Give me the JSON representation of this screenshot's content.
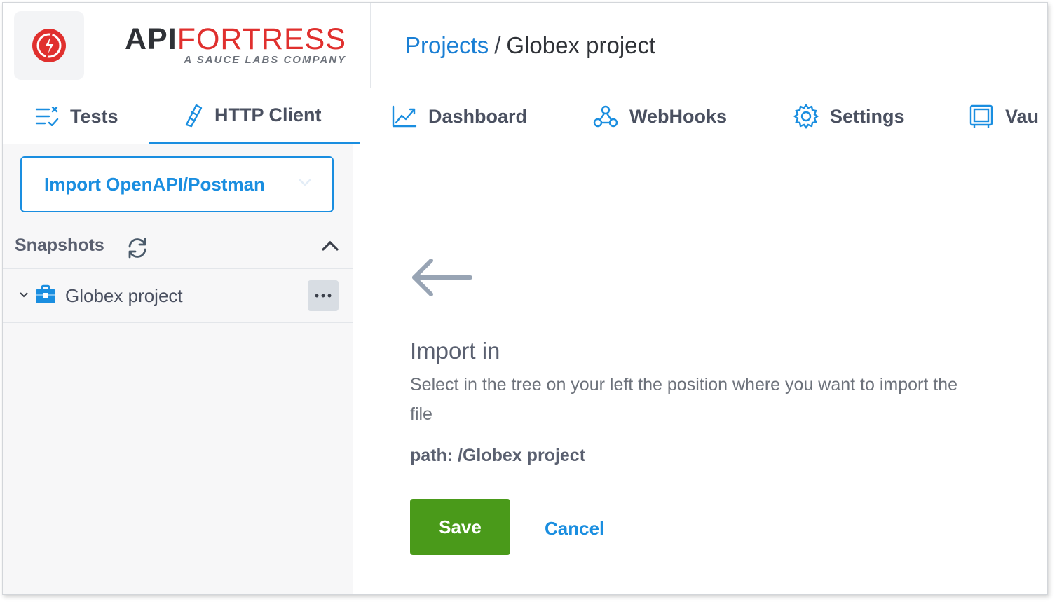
{
  "brand": {
    "api": "API",
    "fortress": "FORTRESS",
    "tagline": "A SAUCE LABS COMPANY"
  },
  "breadcrumb": {
    "link": "Projects",
    "separator": "/",
    "current": "Globex project"
  },
  "tabs": [
    {
      "label": "Tests",
      "icon": "tests-icon"
    },
    {
      "label": "HTTP Client",
      "icon": "http-client-icon",
      "active": true
    },
    {
      "label": "Dashboard",
      "icon": "chart-line-icon"
    },
    {
      "label": "WebHooks",
      "icon": "webhook-icon"
    },
    {
      "label": "Settings",
      "icon": "gear-icon"
    },
    {
      "label": "Vau",
      "icon": "vault-icon"
    }
  ],
  "sidebar": {
    "import_button": "Import OpenAPI/Postman",
    "snapshots_title": "Snapshots",
    "tree": [
      {
        "label": "Globex project",
        "icon": "briefcase-icon"
      }
    ]
  },
  "main": {
    "title": "Import in",
    "description": "Select in the tree on your left the position where you want to import the file",
    "path": "path: /Globex project",
    "save_label": "Save",
    "cancel_label": "Cancel"
  },
  "colors": {
    "accent": "#1a8ee0",
    "brand_red": "#e0302e",
    "save_green": "#4a9a1a"
  }
}
